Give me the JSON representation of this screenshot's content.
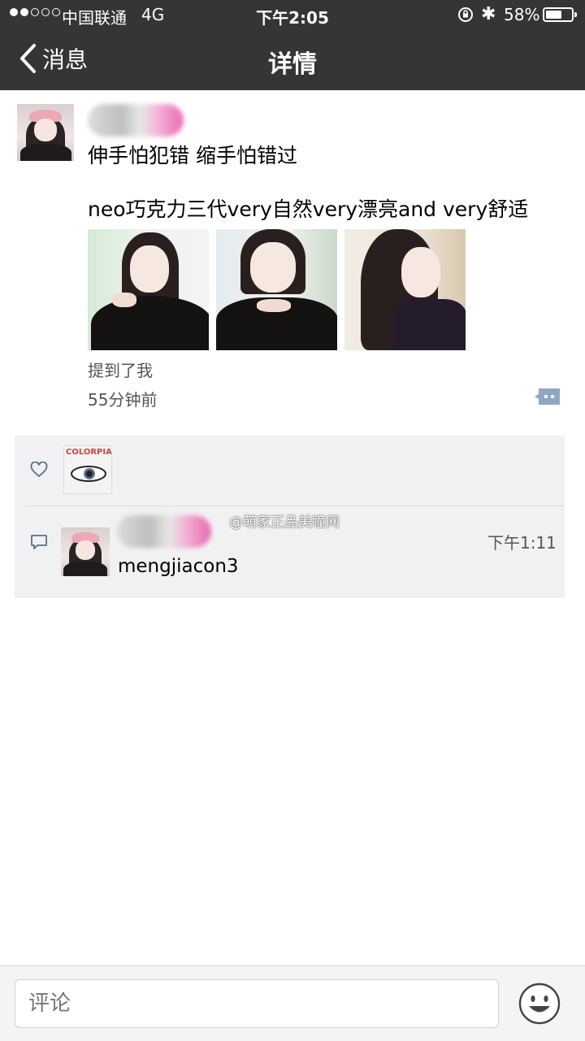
{
  "status_bar": {
    "carrier": "中国联通",
    "network": "4G",
    "time": "下午2:05",
    "battery": "58%",
    "battery_level": 0.58,
    "signal_strength": 2
  },
  "nav": {
    "back_label": "消息",
    "title": "详情"
  },
  "post": {
    "author_name_obscured": true,
    "line1": "伸手怕犯错 缩手怕错过",
    "line2": "neo巧克力三代very自然very漂亮and very舒适",
    "photo_count": 3,
    "mention": "提到了我",
    "time_ago": "55分钟前"
  },
  "interactions": {
    "like_icon": "heart-outline-icon",
    "liker_avatar_text": "COLORPIA",
    "comment_icon": "speech-bubble-icon",
    "comment": {
      "time": "下午1:11",
      "text": "mengjiacon3"
    }
  },
  "watermark": "@萌家正品美瞳网",
  "input": {
    "placeholder": "评论",
    "emoji_icon": "smiley-face-icon"
  }
}
